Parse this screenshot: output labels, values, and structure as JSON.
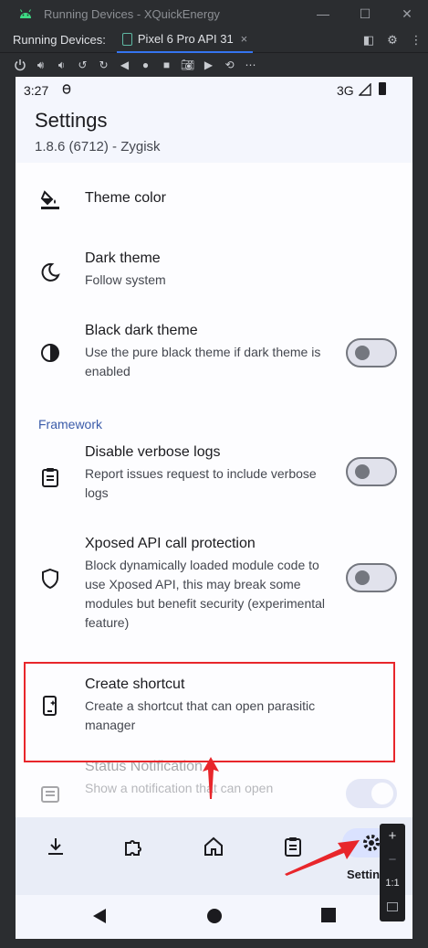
{
  "ide": {
    "window_title": "Running Devices - XQuickEnergy",
    "running_label": "Running Devices:",
    "device_tab": "Pixel 6 Pro API 31",
    "close_glyph": "×"
  },
  "phone": {
    "status": {
      "time": "3:27",
      "network": "3G"
    },
    "header": {
      "title": "Settings",
      "subtitle": "1.8.6 (6712) - Zygisk"
    },
    "items": [
      {
        "title": "Theme color",
        "summary": "",
        "icon": "paint-bucket-icon"
      },
      {
        "title": "Dark theme",
        "summary": "Follow system",
        "icon": "moon-icon"
      },
      {
        "title": "Black dark theme",
        "summary": "Use the pure black theme if dark theme is enabled",
        "icon": "contrast-icon",
        "switch_on": false
      },
      {
        "title": "Disable verbose logs",
        "summary": "Report issues request to include verbose logs",
        "icon": "clipboard-icon",
        "switch_on": false
      },
      {
        "title": "Xposed API call protection",
        "summary": "Block dynamically loaded module code to use Xposed API, this may break some modules but benefit security (experimental feature)",
        "icon": "shield-icon",
        "switch_on": false
      },
      {
        "title": "Create shortcut",
        "summary": "Create a shortcut that can open parasitic manager",
        "icon": "shortcut-icon"
      },
      {
        "title": "Status Notification",
        "summary": "Show a notification that can open",
        "icon": "notification-list-icon",
        "switch_on": true
      }
    ],
    "section_framework": "Framework",
    "nav": {
      "items": [
        "download-icon",
        "puzzle-icon",
        "home-icon",
        "clipboard-list-icon",
        "gear-icon"
      ],
      "active_label": "Settings"
    }
  },
  "zoom": {
    "plus": "+",
    "minus": "−",
    "ratio": "1:1"
  },
  "colors": {
    "highlight": "#e8262b",
    "accent": "#3a5ba9",
    "active_pill": "#dae2ff"
  }
}
